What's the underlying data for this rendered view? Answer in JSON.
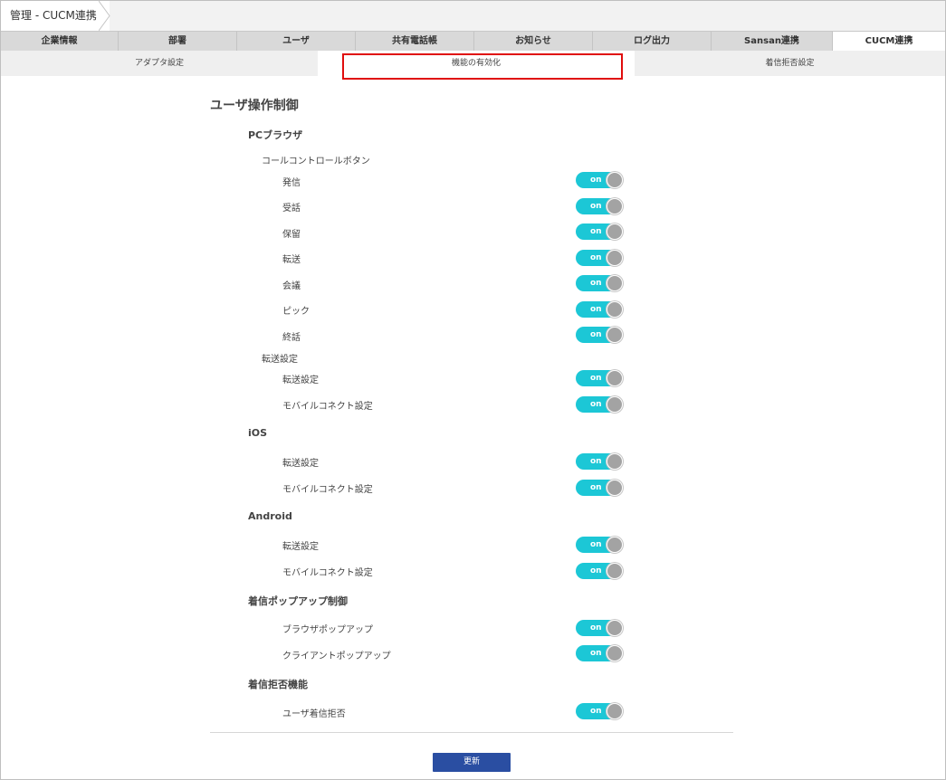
{
  "breadcrumb": {
    "label": "管理 - CUCM連携"
  },
  "tabs": [
    {
      "label": "企業情報"
    },
    {
      "label": "部署"
    },
    {
      "label": "ユーザ"
    },
    {
      "label": "共有電話帳"
    },
    {
      "label": "お知らせ"
    },
    {
      "label": "ログ出力"
    },
    {
      "label": "Sansan連携"
    },
    {
      "label": "CUCM連携",
      "active": true
    }
  ],
  "subtabs": [
    {
      "label": "アダプタ設定"
    },
    {
      "label": "機能の有効化",
      "active": true
    },
    {
      "label": "着信拒否設定"
    }
  ],
  "section_title": "ユーザ操作制御",
  "groups": {
    "pc": {
      "title": "PCブラウザ",
      "call_control": {
        "title": "コールコントロールボタン",
        "items": [
          "発信",
          "受話",
          "保留",
          "転送",
          "会議",
          "ピック",
          "終話"
        ]
      },
      "transfer": {
        "title": "転送設定",
        "items": [
          "転送設定",
          "モバイルコネクト設定"
        ]
      }
    },
    "ios": {
      "title": "iOS",
      "items": [
        "転送設定",
        "モバイルコネクト設定"
      ]
    },
    "android": {
      "title": "Android",
      "items": [
        "転送設定",
        "モバイルコネクト設定"
      ]
    },
    "popup": {
      "title": "着信ポップアップ制御",
      "items": [
        "ブラウザポップアップ",
        "クライアントポップアップ"
      ]
    },
    "reject": {
      "title": "着信拒否機能",
      "items": [
        "ユーザ着信拒否"
      ]
    }
  },
  "toggle_label": "on",
  "update_button": "更新",
  "colors": {
    "toggle_on": "#1cc7d6",
    "button": "#2a4ea2",
    "highlight": "#e00d0d"
  }
}
